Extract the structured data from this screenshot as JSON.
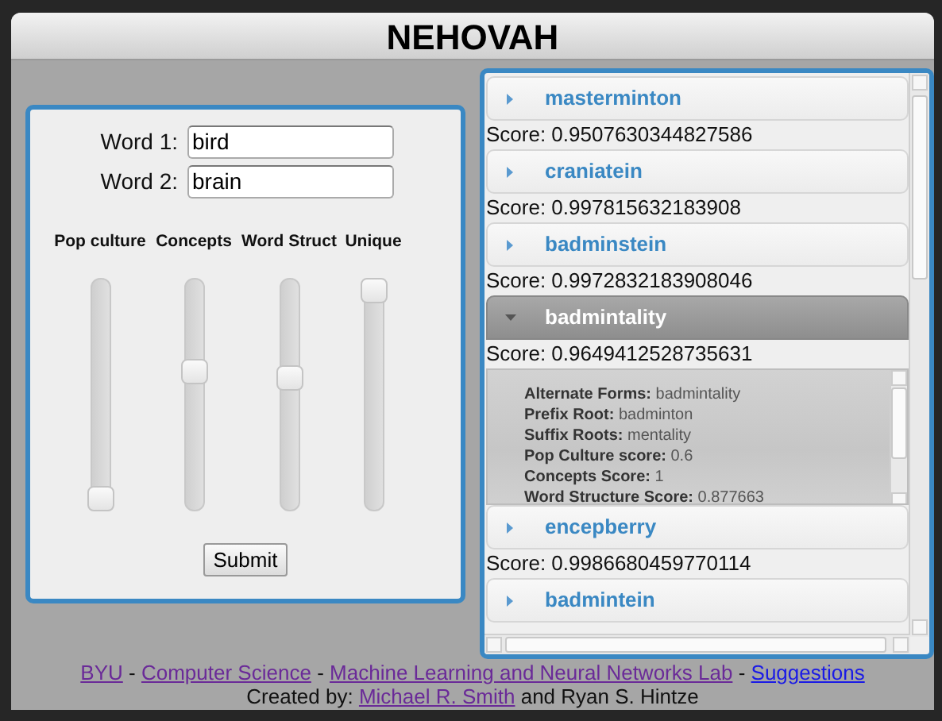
{
  "header": {
    "title": "NEHOVAH"
  },
  "form": {
    "fields": [
      {
        "label": "Word 1:",
        "value": "bird"
      },
      {
        "label": "Word 2:",
        "value": "brain"
      }
    ],
    "sliders": [
      {
        "label": "Pop culture",
        "level": 0
      },
      {
        "label": "Concepts",
        "level": 0.61
      },
      {
        "label": "Word Struct",
        "level": 0.58
      },
      {
        "label": "Unique",
        "level": 1
      }
    ],
    "submit": "Submit"
  },
  "results": [
    {
      "name": "masterminton",
      "expanded": false,
      "score": "Score: 0.9507630344827586"
    },
    {
      "name": "craniatein",
      "expanded": false,
      "score": "Score: 0.997815632183908"
    },
    {
      "name": "badminstein",
      "expanded": false,
      "score": "Score: 0.9972832183908046"
    },
    {
      "name": "badmintality",
      "expanded": true,
      "score": "Score: 0.9649412528735631",
      "details": [
        "**Alternate Forms:** badmintality",
        "**Prefix Root:** badminton",
        "**Suffix Roots:** mentality",
        "**Pop Culture score:** 0.6",
        "**Concepts Score:** 1",
        "**Word Structure Score:** 0.877663"
      ]
    },
    {
      "name": "encepberry",
      "expanded": false,
      "score": "Score: 0.9986680459770114"
    },
    {
      "name": "badmintein",
      "expanded": false
    }
  ],
  "footer": {
    "links": [
      {
        "text": "BYU",
        "visited": true
      },
      {
        "text": "Computer Science",
        "visited": true
      },
      {
        "text": "Machine Learning and Neural Networks Lab",
        "visited": true
      },
      {
        "text": "Suggestions",
        "visited": false
      }
    ],
    "separator": "-",
    "credit_prefix": "Created by:",
    "credit_link": {
      "text": "Michael R. Smith",
      "visited": true
    },
    "credit_suffix": "and Ryan S. Hintze"
  }
}
